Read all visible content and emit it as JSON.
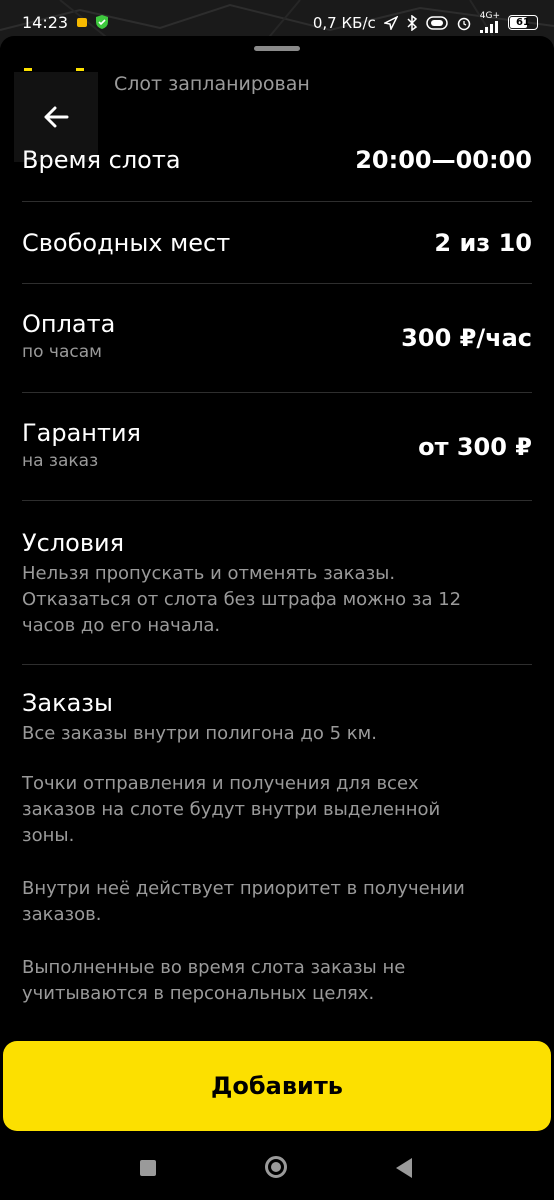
{
  "status_bar": {
    "time": "14:23",
    "net_speed": "0,7 КБ/с",
    "network": "4G+",
    "battery": "61"
  },
  "header": {
    "title": "Слот запланирован"
  },
  "rows": {
    "slot_time": {
      "label": "Время слота",
      "value": "20:00—00:00"
    },
    "free_places": {
      "label": "Свободных мест",
      "value": "2 из 10"
    },
    "payment": {
      "label": "Оплата",
      "sublabel": "по часам",
      "value": "300 ₽/час"
    },
    "guarantee": {
      "label": "Гарантия",
      "sublabel": "на заказ",
      "value": "от 300 ₽"
    }
  },
  "conditions": {
    "title": "Условия",
    "lines": [
      "Нельзя пропускать и отменять заказы.",
      "Отказаться от слота без штрафа можно за 12",
      "часов до его начала."
    ]
  },
  "orders": {
    "title": "Заказы",
    "p1": "Все заказы внутри полигона до 5 км.",
    "p2_lines": [
      "Точки отправления и получения для всех",
      "заказов на слоте будут внутри выделенной",
      "зоны."
    ],
    "p3_lines": [
      "Внутри неё действует приоритет в получении",
      "заказов."
    ],
    "p4_lines": [
      "Выполненные во время слота заказы не",
      "учитываются в персональных целях."
    ]
  },
  "actions": {
    "add_label": "Добавить",
    "add_color": "#fce000"
  },
  "icons": {
    "back": "arrow-left-icon",
    "location": "location-arrow-icon",
    "bluetooth": "bluetooth-icon",
    "signal": "signal-icon",
    "wifi": "wifi-icon",
    "alarm": "alarm-icon"
  }
}
